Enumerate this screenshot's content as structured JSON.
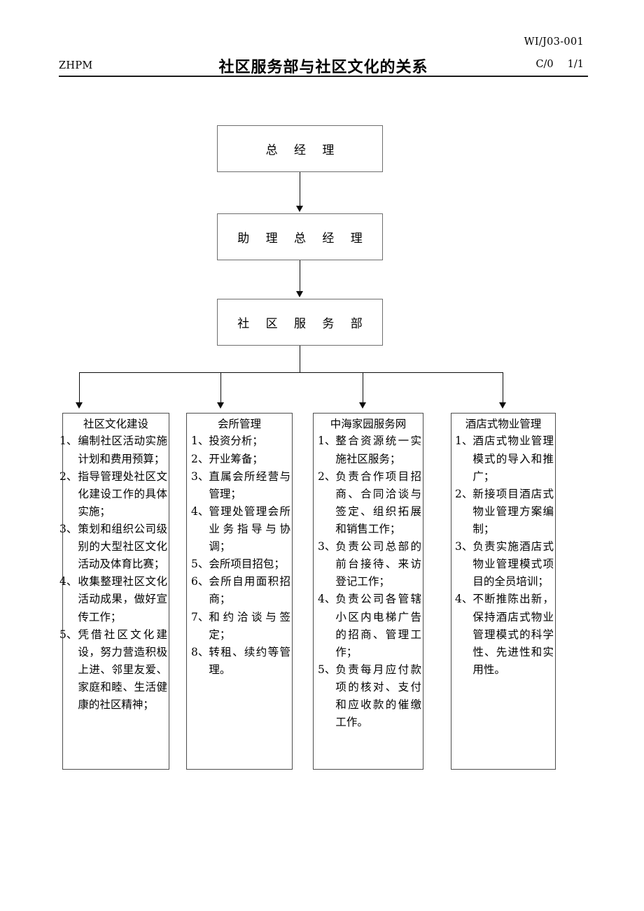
{
  "header": {
    "org": "ZHPM",
    "title": "社区服务部与社区文化的关系",
    "doc_code": "WI/J03-001",
    "revision": "C/0",
    "page": "1/1"
  },
  "hierarchy": {
    "level1": "总  经  理",
    "level2": "助 理 总 经 理",
    "level3": "社 区 服 务 部"
  },
  "columns": [
    {
      "title": "社区文化建设",
      "items": [
        {
          "num": "1、",
          "text": "编制社区活动实施计划和费用预算；"
        },
        {
          "num": "2、",
          "text": "指导管理处社区文化建设工作的具体实施；"
        },
        {
          "num": "3、",
          "text": "策划和组织公司级别的大型社区文化活动及体育比赛；"
        },
        {
          "num": "4、",
          "text": "收集整理社区文化活动成果，做好宣传工作；"
        },
        {
          "num": "5、",
          "text": "凭借社区文化建设，努力营造积极上进、邻里友爱、家庭和睦、生活健康的社区精神；"
        }
      ]
    },
    {
      "title": "会所管理",
      "items": [
        {
          "num": "1、",
          "text": "投资分析；"
        },
        {
          "num": "2、",
          "text": "开业筹备；"
        },
        {
          "num": "3、",
          "text": "直属会所经营与管理；"
        },
        {
          "num": "4、",
          "text": "管理处管理会所业务指导与协调；"
        },
        {
          "num": "5、",
          "text": "会所项目招包；"
        },
        {
          "num": "6、",
          "text": "会所自用面积招商；"
        },
        {
          "num": "7、",
          "text": "和约洽谈与签定；"
        },
        {
          "num": "8、",
          "text": "转租、续约等管理。"
        }
      ]
    },
    {
      "title": "中海家园服务网",
      "items": [
        {
          "num": "1、",
          "text": "整合资源统一实施社区服务；"
        },
        {
          "num": "2、",
          "text": "负责合作项目招商、合同洽谈与签定、组织拓展和销售工作；"
        },
        {
          "num": "3、",
          "text": "负责公司总部的前台接待、来访登记工作；"
        },
        {
          "num": "4、",
          "text": "负责公司各管辖小区内电梯广告的招商、管理工作；"
        },
        {
          "num": "5、",
          "text": "负责每月应付款项的核对、支付和应收款的催缴工作。"
        }
      ]
    },
    {
      "title": "酒店式物业管理",
      "items": [
        {
          "num": "1、",
          "text": "酒店式物业管理模式的导入和推广；"
        },
        {
          "num": "2、",
          "text": "新接项目酒店式物业管理方案编制；"
        },
        {
          "num": "3、",
          "text": "负责实施酒店式物业管理模式项目的全员培训；"
        },
        {
          "num": "4、",
          "text": "不断推陈出新，保持酒店式物业管理模式的科学性、先进性和实用性。"
        }
      ]
    }
  ]
}
